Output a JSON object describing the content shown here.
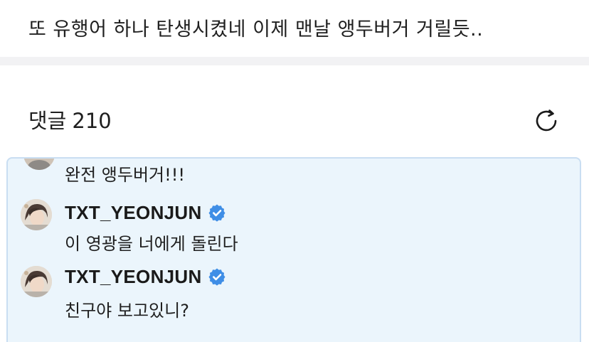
{
  "post": {
    "text": "또 유행어 하나 탄생시켰네 이제 맨날 앵두버거 거릴듯.."
  },
  "comments": {
    "label": "댓글",
    "count": "210",
    "refresh_icon": "refresh-icon"
  },
  "thread": {
    "first_reply_text": "완전 앵두버거!!!",
    "replies": [
      {
        "username": "TXT_YEONJUN",
        "verified": true,
        "text": "이 영광을 너에게 돌린다"
      },
      {
        "username": "TXT_YEONJUN",
        "verified": true,
        "text": "친구야 보고있니?"
      }
    ]
  },
  "colors": {
    "highlight_bg": "#ebf5fc",
    "highlight_border": "#c9def2",
    "verified_blue": "#3f8ee6"
  }
}
